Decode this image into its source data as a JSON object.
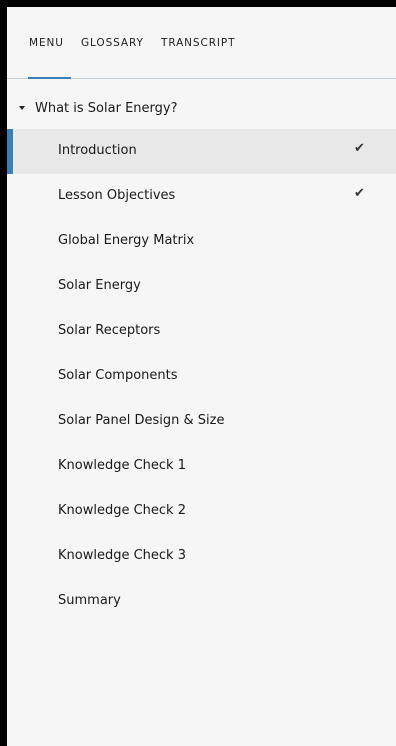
{
  "tabs": [
    {
      "label": "MENU"
    },
    {
      "label": "GLOSSARY"
    },
    {
      "label": "TRANSCRIPT"
    }
  ],
  "section": {
    "title": "What is Solar Energy?",
    "expanded": true
  },
  "items": [
    {
      "label": "Introduction",
      "completed": "✔",
      "active": true
    },
    {
      "label": "Lesson Objectives",
      "completed": "✔",
      "active": false
    },
    {
      "label": "Global Energy Matrix"
    },
    {
      "label": "Solar Energy"
    },
    {
      "label": "Solar Receptors"
    },
    {
      "label": "Solar Components"
    },
    {
      "label": "Solar Panel Design & Size"
    },
    {
      "label": "Knowledge Check 1"
    },
    {
      "label": "Knowledge Check 2"
    },
    {
      "label": "Knowledge Check 3"
    },
    {
      "label": "Summary"
    }
  ],
  "colors": {
    "accent": "#3a7fb6",
    "panel_bg": "#f6f6f6",
    "active_bg": "#e8e8e8",
    "frame": "#000000"
  }
}
